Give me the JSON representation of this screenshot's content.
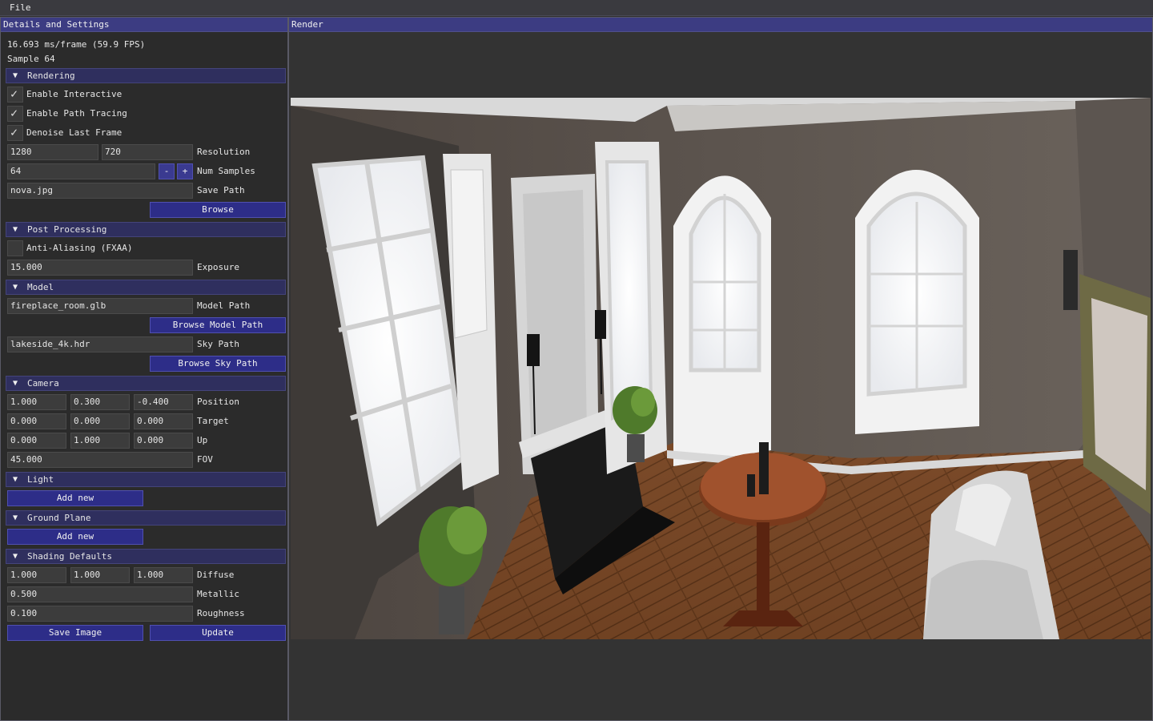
{
  "menubar": {
    "file_label": "File"
  },
  "left_panel": {
    "title": "Details and Settings",
    "stats": {
      "frame_time": "16.693 ms/frame (59.9 FPS)",
      "sample": "Sample 64"
    },
    "rendering": {
      "header": "Rendering",
      "enable_interactive": {
        "label": "Enable Interactive",
        "checked": true
      },
      "enable_path_tracing": {
        "label": "Enable Path Tracing",
        "checked": true
      },
      "denoise_last_frame": {
        "label": "Denoise Last Frame",
        "checked": true
      },
      "resolution": {
        "width": "1280",
        "height": "720",
        "label": "Resolution"
      },
      "num_samples": {
        "value": "64",
        "minus": "-",
        "plus": "+",
        "label": "Num Samples"
      },
      "save_path": {
        "value": "nova.jpg",
        "label": "Save Path"
      },
      "browse_label": "Browse"
    },
    "post_processing": {
      "header": "Post Processing",
      "anti_aliasing": {
        "label": "Anti-Aliasing (FXAA)",
        "checked": false
      },
      "exposure": {
        "value": "15.000",
        "label": "Exposure"
      }
    },
    "model": {
      "header": "Model",
      "model_path": {
        "value": "fireplace_room.glb",
        "label": "Model Path"
      },
      "browse_model_label": "Browse Model Path",
      "sky_path": {
        "value": "lakeside_4k.hdr",
        "label": "Sky Path"
      },
      "browse_sky_label": "Browse Sky Path"
    },
    "camera": {
      "header": "Camera",
      "position": {
        "x": "1.000",
        "y": "0.300",
        "z": "-0.400",
        "label": "Position"
      },
      "target": {
        "x": "0.000",
        "y": "0.000",
        "z": "0.000",
        "label": "Target"
      },
      "up": {
        "x": "0.000",
        "y": "1.000",
        "z": "0.000",
        "label": "Up"
      },
      "fov": {
        "value": "45.000",
        "label": "FOV"
      }
    },
    "light": {
      "header": "Light",
      "add_new_label": "Add new"
    },
    "ground_plane": {
      "header": "Ground Plane",
      "add_new_label": "Add new"
    },
    "shading_defaults": {
      "header": "Shading Defaults",
      "diffuse": {
        "r": "1.000",
        "g": "1.000",
        "b": "1.000",
        "label": "Diffuse"
      },
      "metallic": {
        "value": "0.500",
        "label": "Metallic"
      },
      "roughness": {
        "value": "0.100",
        "label": "Roughness"
      }
    },
    "save_image_label": "Save Image",
    "update_label": "Update"
  },
  "right_panel": {
    "title": "Render"
  },
  "icons": {
    "collapse": "triangle-down-icon",
    "check": "checkmark-icon"
  },
  "colors": {
    "title_bar": "#3c3c82",
    "header": "#2f2f5e",
    "button": "#2d2d88",
    "panel_bg": "#2b2b2b"
  }
}
